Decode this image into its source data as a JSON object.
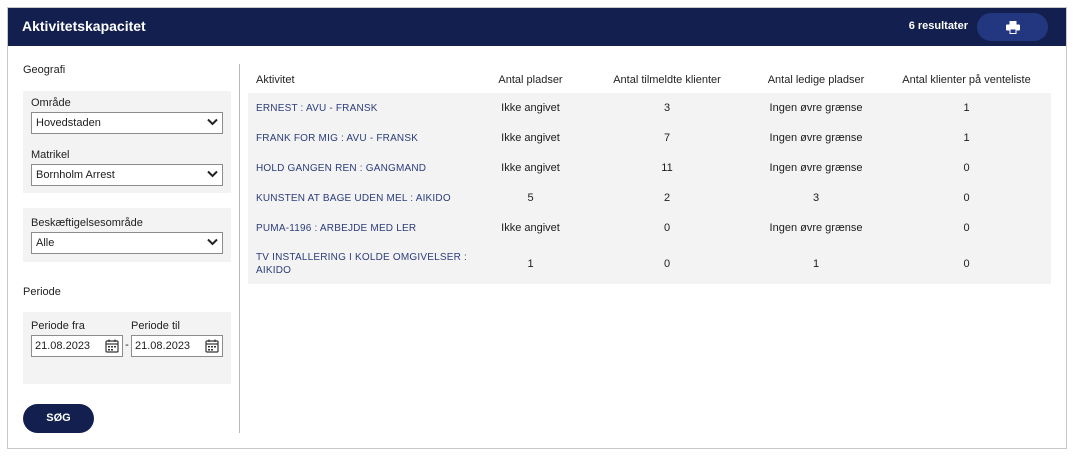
{
  "header": {
    "title": "Aktivitetskapacitet",
    "result_count": "6 resultater",
    "print_icon": "printer-icon"
  },
  "sidebar": {
    "geografi_title": "Geografi",
    "omraade": {
      "label": "Område",
      "value": "Hovedstaden"
    },
    "matrikel": {
      "label": "Matrikel",
      "value": "Bornholm Arrest"
    },
    "beskaeftigelse": {
      "label": "Beskæftigelsesområde",
      "value": "Alle"
    },
    "periode_title": "Periode",
    "periode_fra": {
      "label": "Periode fra",
      "value": "21.08.2023"
    },
    "periode_til": {
      "label": "Periode til",
      "value": "21.08.2023"
    },
    "separator": "-",
    "search_label": "SØG"
  },
  "table": {
    "headers": [
      "Aktivitet",
      "Antal pladser",
      "Antal tilmeldte klienter",
      "Antal ledige pladser",
      "Antal klienter på venteliste"
    ],
    "rows": [
      [
        "ERNEST : AVU - FRANSK",
        "Ikke angivet",
        "3",
        "Ingen øvre grænse",
        "1"
      ],
      [
        "FRANK FOR MIG : AVU - FRANSK",
        "Ikke angivet",
        "7",
        "Ingen øvre grænse",
        "1"
      ],
      [
        "HOLD GANGEN REN : GANGMAND",
        "Ikke angivet",
        "11",
        "Ingen øvre grænse",
        "0"
      ],
      [
        "KUNSTEN AT BAGE UDEN MEL : AIKIDO",
        "5",
        "2",
        "3",
        "0"
      ],
      [
        "PUMA-1196 : ARBEJDE MED LER",
        "Ikke angivet",
        "0",
        "Ingen øvre grænse",
        "0"
      ],
      [
        "TV INSTALLERING I KOLDE OMGIVELSER : AIKIDO",
        "1",
        "0",
        "1",
        "0"
      ]
    ]
  },
  "colors": {
    "header_bg": "#13204f",
    "button_bg": "#233780",
    "link_text": "#2c3d7a",
    "panel_bg": "#f3f3f3"
  }
}
